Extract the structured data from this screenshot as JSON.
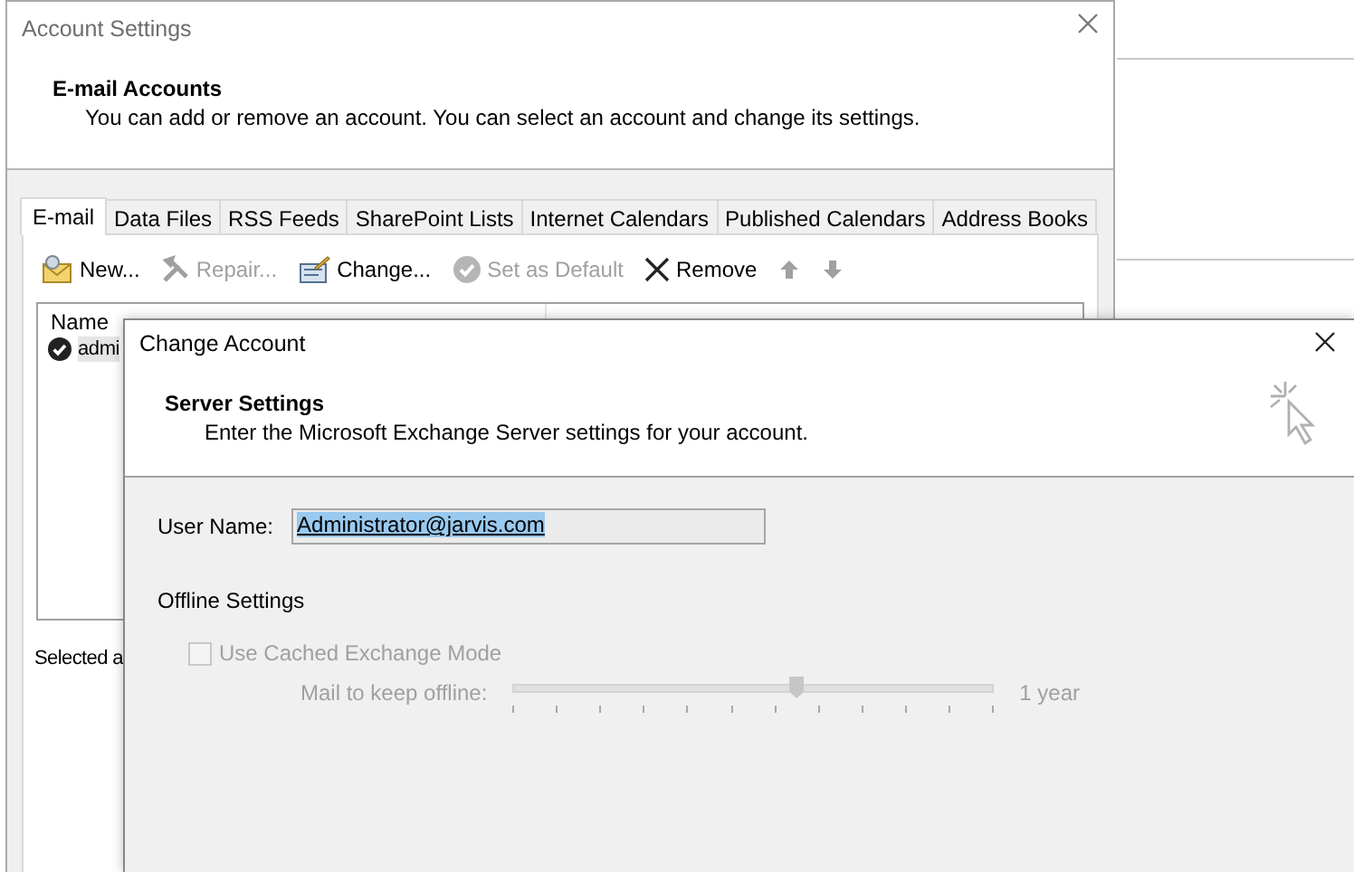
{
  "account_settings": {
    "title": "Account Settings",
    "heading": "E-mail Accounts",
    "description": "You can add or remove an account. You can select an account and change its settings.",
    "tabs": [
      {
        "label": "E-mail",
        "selected": true
      },
      {
        "label": "Data Files",
        "selected": false
      },
      {
        "label": "RSS Feeds",
        "selected": false
      },
      {
        "label": "SharePoint Lists",
        "selected": false
      },
      {
        "label": "Internet Calendars",
        "selected": false
      },
      {
        "label": "Published Calendars",
        "selected": false
      },
      {
        "label": "Address Books",
        "selected": false
      }
    ],
    "toolbar": [
      {
        "kind": "new",
        "label": "New...",
        "disabled": false
      },
      {
        "kind": "repair",
        "label": "Repair...",
        "disabled": true
      },
      {
        "kind": "change",
        "label": "Change...",
        "disabled": false
      },
      {
        "kind": "default",
        "label": "Set as Default",
        "disabled": true
      },
      {
        "kind": "remove",
        "label": "Remove",
        "disabled": false
      },
      {
        "kind": "up",
        "disabled": true
      },
      {
        "kind": "down",
        "disabled": true
      }
    ],
    "list": {
      "column": "Name",
      "accounts": [
        {
          "name": "admi",
          "selected": true,
          "default": true
        }
      ]
    },
    "footer": "Selected a"
  },
  "change_account": {
    "title": "Change Account",
    "heading": "Server Settings",
    "description": "Enter the Microsoft Exchange Server settings for your account.",
    "user_name": {
      "label": "User Name:",
      "value": "Administrator@jarvis.com"
    },
    "offline": {
      "heading": "Offline Settings",
      "cached_mode": {
        "label": "Use Cached Exchange Mode",
        "checked": false,
        "disabled": true
      },
      "slider": {
        "label": "Mail to keep offline:",
        "level": 0.59,
        "reading": "1 year",
        "disabled": true
      }
    }
  }
}
